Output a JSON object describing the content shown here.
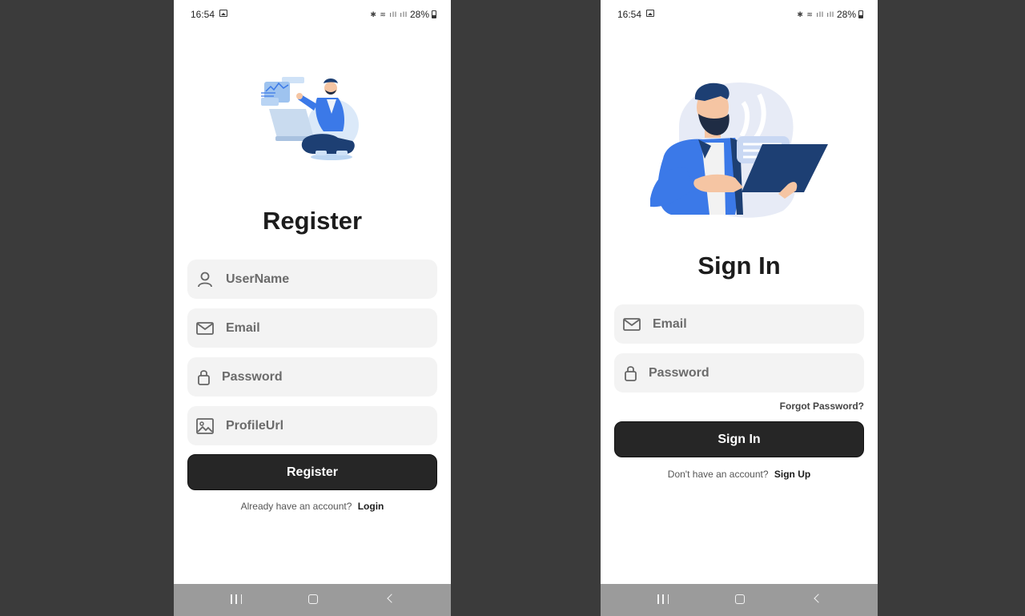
{
  "status_bar": {
    "time": "16:54",
    "battery": "28%"
  },
  "register": {
    "title": "Register",
    "fields": {
      "username": {
        "placeholder": "UserName"
      },
      "email": {
        "placeholder": "Email"
      },
      "password": {
        "placeholder": "Password"
      },
      "profile_url": {
        "placeholder": "ProfileUrl"
      }
    },
    "button_label": "Register",
    "footer_text": "Already have an account?",
    "footer_link": "Login"
  },
  "signin": {
    "title": "Sign In",
    "fields": {
      "email": {
        "placeholder": "Email"
      },
      "password": {
        "placeholder": "Password"
      }
    },
    "forgot_label": "Forgot Password?",
    "button_label": "Sign In",
    "footer_text": "Don't have an account?",
    "footer_link": "Sign Up"
  },
  "icons": {
    "user": "user-icon",
    "email": "mail-icon",
    "password": "lock-icon",
    "profile": "image-icon",
    "nav_recents": "recents-icon",
    "nav_home": "home-icon",
    "nav_back": "back-icon"
  },
  "colors": {
    "screen_bg": "#3b3b3b",
    "field_bg": "#f3f3f3",
    "button_bg": "#262626",
    "accent_blue": "#3b79e8",
    "navbar_bg": "#9b9b9b"
  }
}
